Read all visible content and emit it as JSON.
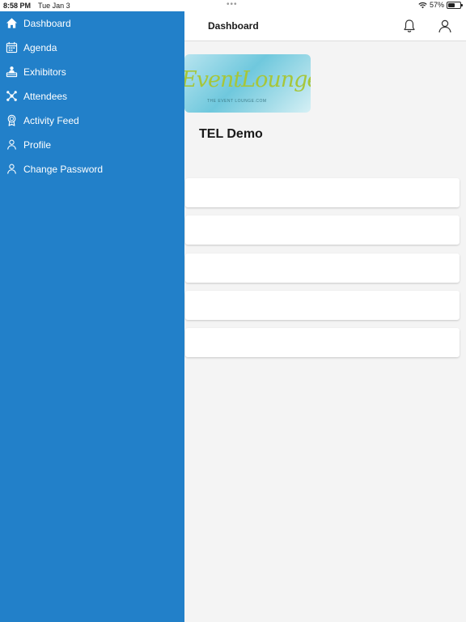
{
  "status": {
    "time": "8:58 PM",
    "date": "Tue Jan 3",
    "battery": "57%",
    "battery_level": 0.57
  },
  "header": {
    "title": "Dashboard",
    "icons": [
      "bell-icon",
      "user-icon"
    ]
  },
  "event": {
    "logo_text": "EventLounge",
    "logo_sub": "THE EVENT LOUNGE.COM",
    "title": "TEL Demo"
  },
  "menu": {
    "items": [
      {
        "label": "Dashboard",
        "icon": "home-icon"
      },
      {
        "label": "Agenda",
        "icon": "calendar-icon"
      },
      {
        "label": "Exhibitors",
        "icon": "exhibitor-icon"
      },
      {
        "label": "Attendees",
        "icon": "network-icon"
      },
      {
        "label": "Activity Feed",
        "icon": "badge-icon"
      },
      {
        "label": "Profile",
        "icon": "person-icon"
      },
      {
        "label": "Change Password",
        "icon": "person-icon"
      }
    ]
  },
  "colors": {
    "drawer": "#2280c9",
    "logo_text": "#a6c63a",
    "logo_bg": "#6fc8dd"
  }
}
